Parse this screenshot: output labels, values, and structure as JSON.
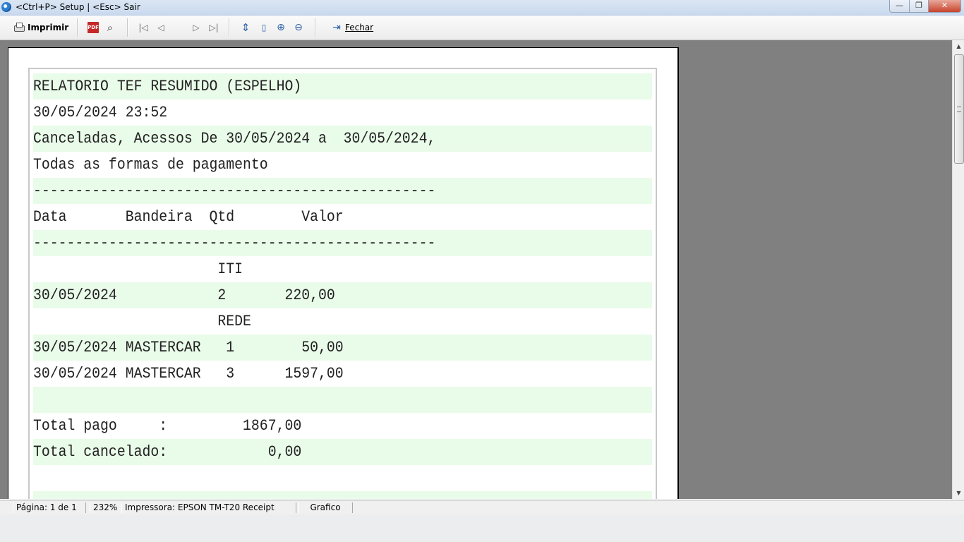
{
  "window": {
    "title": "<Ctrl+P> Setup | <Esc> Sair",
    "min_glyph": "—",
    "max_glyph": "❐",
    "close_glyph": "✕"
  },
  "toolbar": {
    "print_label": "Imprimir",
    "pdf_glyph": "PDF",
    "find_glyph": "⌕",
    "first_glyph": "|◁",
    "prev_glyph": "◁",
    "next_glyph": "▷",
    "last_glyph": "▷|",
    "fit_width_glyph": "⇕",
    "whole_page_glyph": "▯",
    "zoom_in_glyph": "⊕",
    "zoom_out_glyph": "⊖",
    "close_label": "Fechar"
  },
  "report": {
    "lines": [
      "RELATORIO TEF RESUMIDO (ESPELHO)",
      "30/05/2024 23:52",
      "Canceladas, Acessos De 30/05/2024 a  30/05/2024,",
      "Todas as formas de pagamento",
      "------------------------------------------------",
      "Data       Bandeira  Qtd        Valor",
      "------------------------------------------------",
      "                      ITI",
      "30/05/2024            2       220,00",
      "                      REDE",
      "30/05/2024 MASTERCAR   1        50,00",
      "30/05/2024 MASTERCAR   3      1597,00",
      "",
      "Total pago     :         1867,00",
      "Total cancelado:            0,00",
      "",
      ""
    ]
  },
  "scrollbar": {
    "up_glyph": "▲",
    "down_glyph": "▼"
  },
  "status": {
    "page": "Página: 1 de 1",
    "zoom": "232%",
    "printer": "Impressora: EPSON TM-T20 Receipt",
    "mode": "Grafico"
  }
}
